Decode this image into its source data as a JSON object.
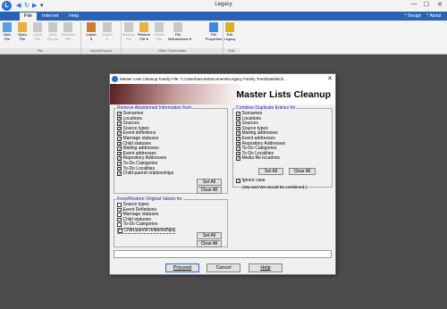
{
  "app": {
    "title": "Legacy",
    "logo": "L"
  },
  "titlebar": {
    "qat": [
      "◀",
      "↻",
      "▶",
      "▾"
    ],
    "min": "—",
    "max": "☐",
    "close": "✕"
  },
  "menu": {
    "tabs": [
      "File",
      "Internet",
      "Help"
    ],
    "right": [
      "^ Design",
      "^ About"
    ]
  },
  "ribbon": {
    "buttons": [
      {
        "label": "New\nFile",
        "color": "#5aa0e0",
        "dim": false
      },
      {
        "label": "Open\nFile",
        "color": "#e8b040",
        "dim": false
      },
      {
        "label": "Close\nFile",
        "color": "#c8c8c8",
        "dim": true
      },
      {
        "label": "Save\nFile As",
        "color": "#c8c8c8",
        "dim": true
      },
      {
        "label": "Rename\nFile",
        "color": "#c8c8c8",
        "dim": true
      },
      {
        "label": "Import\n▾",
        "color": "#d07a30",
        "dim": false
      },
      {
        "label": "Export\n▾",
        "color": "#c8c8c8",
        "dim": true
      },
      {
        "label": "Backup\nFile",
        "color": "#c8c8c8",
        "dim": true
      },
      {
        "label": "Restore\nFile ▾",
        "color": "#e8b040",
        "dim": false
      },
      {
        "label": "Delete\nFile",
        "color": "#c8c8c8",
        "dim": true
      },
      {
        "label": "File\nMaintenance ▾",
        "color": "#c8c8c8",
        "dim": false
      },
      {
        "label": "File\nProperties",
        "color": "#3a8ad8",
        "dim": false
      },
      {
        "label": "Exit\nLegacy",
        "color": "#d8b020",
        "dim": false
      }
    ],
    "groups": [
      "File",
      "Import/Export",
      "Other Commands",
      "Exit"
    ]
  },
  "dialog": {
    "title": "Master Lists Cleanup   Family File: C:\\Users\\ancesDocuments\\Legacy Family Tree\\Data\\Mich...",
    "close": "✕",
    "header": "Master Lists Cleanup",
    "remove": {
      "legend": "Remove Abandoned Information from",
      "items": [
        "Surnames",
        "Locations",
        "Sources",
        "Source types",
        "Event definitions",
        "Marriage statuses",
        "Child statuses",
        "Mailing addresses",
        "Event addresses",
        "Repository Addresses",
        "To-Do Categories",
        "To-Do Localities",
        "Child-parent relationships"
      ],
      "set_all": "Set All",
      "clear_all": "Clear All"
    },
    "combine": {
      "legend": "Combine Duplicate Entries for",
      "items": [
        "Surnames",
        "Locations",
        "Sources",
        "Source types",
        "Mailing addresses",
        "Event addresses",
        "Repository Addresses",
        "To-Do Categories",
        "To-Do Localities",
        "Media file locations"
      ],
      "set_all": "Set All",
      "clear_all": "Clear All",
      "ignore_case": "Ignore case",
      "note": "(Wa and WA would be combined.)"
    },
    "restore": {
      "legend": "Keep/Restore Original Values for",
      "items": [
        "Source types",
        "Event Definitions",
        "Marriage statuses",
        "Child statuses",
        "To-Do Categories",
        "Child-parent relationships"
      ],
      "set_all": "Set All",
      "clear_all": "Clear All"
    },
    "buttons": {
      "proceed": "Proceed",
      "cancel": "Cancel",
      "help": "Help"
    }
  }
}
